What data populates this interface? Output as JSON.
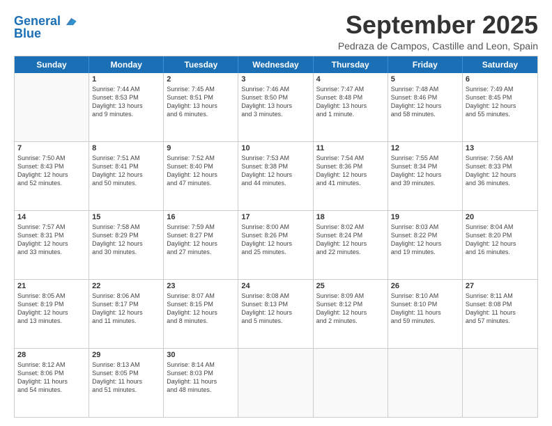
{
  "logo": {
    "line1": "General",
    "line2": "Blue"
  },
  "title": "September 2025",
  "subtitle": "Pedraza de Campos, Castille and Leon, Spain",
  "weekdays": [
    "Sunday",
    "Monday",
    "Tuesday",
    "Wednesday",
    "Thursday",
    "Friday",
    "Saturday"
  ],
  "weeks": [
    [
      {
        "day": "",
        "lines": []
      },
      {
        "day": "1",
        "lines": [
          "Sunrise: 7:44 AM",
          "Sunset: 8:53 PM",
          "Daylight: 13 hours",
          "and 9 minutes."
        ]
      },
      {
        "day": "2",
        "lines": [
          "Sunrise: 7:45 AM",
          "Sunset: 8:51 PM",
          "Daylight: 13 hours",
          "and 6 minutes."
        ]
      },
      {
        "day": "3",
        "lines": [
          "Sunrise: 7:46 AM",
          "Sunset: 8:50 PM",
          "Daylight: 13 hours",
          "and 3 minutes."
        ]
      },
      {
        "day": "4",
        "lines": [
          "Sunrise: 7:47 AM",
          "Sunset: 8:48 PM",
          "Daylight: 13 hours",
          "and 1 minute."
        ]
      },
      {
        "day": "5",
        "lines": [
          "Sunrise: 7:48 AM",
          "Sunset: 8:46 PM",
          "Daylight: 12 hours",
          "and 58 minutes."
        ]
      },
      {
        "day": "6",
        "lines": [
          "Sunrise: 7:49 AM",
          "Sunset: 8:45 PM",
          "Daylight: 12 hours",
          "and 55 minutes."
        ]
      }
    ],
    [
      {
        "day": "7",
        "lines": [
          "Sunrise: 7:50 AM",
          "Sunset: 8:43 PM",
          "Daylight: 12 hours",
          "and 52 minutes."
        ]
      },
      {
        "day": "8",
        "lines": [
          "Sunrise: 7:51 AM",
          "Sunset: 8:41 PM",
          "Daylight: 12 hours",
          "and 50 minutes."
        ]
      },
      {
        "day": "9",
        "lines": [
          "Sunrise: 7:52 AM",
          "Sunset: 8:40 PM",
          "Daylight: 12 hours",
          "and 47 minutes."
        ]
      },
      {
        "day": "10",
        "lines": [
          "Sunrise: 7:53 AM",
          "Sunset: 8:38 PM",
          "Daylight: 12 hours",
          "and 44 minutes."
        ]
      },
      {
        "day": "11",
        "lines": [
          "Sunrise: 7:54 AM",
          "Sunset: 8:36 PM",
          "Daylight: 12 hours",
          "and 41 minutes."
        ]
      },
      {
        "day": "12",
        "lines": [
          "Sunrise: 7:55 AM",
          "Sunset: 8:34 PM",
          "Daylight: 12 hours",
          "and 39 minutes."
        ]
      },
      {
        "day": "13",
        "lines": [
          "Sunrise: 7:56 AM",
          "Sunset: 8:33 PM",
          "Daylight: 12 hours",
          "and 36 minutes."
        ]
      }
    ],
    [
      {
        "day": "14",
        "lines": [
          "Sunrise: 7:57 AM",
          "Sunset: 8:31 PM",
          "Daylight: 12 hours",
          "and 33 minutes."
        ]
      },
      {
        "day": "15",
        "lines": [
          "Sunrise: 7:58 AM",
          "Sunset: 8:29 PM",
          "Daylight: 12 hours",
          "and 30 minutes."
        ]
      },
      {
        "day": "16",
        "lines": [
          "Sunrise: 7:59 AM",
          "Sunset: 8:27 PM",
          "Daylight: 12 hours",
          "and 27 minutes."
        ]
      },
      {
        "day": "17",
        "lines": [
          "Sunrise: 8:00 AM",
          "Sunset: 8:26 PM",
          "Daylight: 12 hours",
          "and 25 minutes."
        ]
      },
      {
        "day": "18",
        "lines": [
          "Sunrise: 8:02 AM",
          "Sunset: 8:24 PM",
          "Daylight: 12 hours",
          "and 22 minutes."
        ]
      },
      {
        "day": "19",
        "lines": [
          "Sunrise: 8:03 AM",
          "Sunset: 8:22 PM",
          "Daylight: 12 hours",
          "and 19 minutes."
        ]
      },
      {
        "day": "20",
        "lines": [
          "Sunrise: 8:04 AM",
          "Sunset: 8:20 PM",
          "Daylight: 12 hours",
          "and 16 minutes."
        ]
      }
    ],
    [
      {
        "day": "21",
        "lines": [
          "Sunrise: 8:05 AM",
          "Sunset: 8:19 PM",
          "Daylight: 12 hours",
          "and 13 minutes."
        ]
      },
      {
        "day": "22",
        "lines": [
          "Sunrise: 8:06 AM",
          "Sunset: 8:17 PM",
          "Daylight: 12 hours",
          "and 11 minutes."
        ]
      },
      {
        "day": "23",
        "lines": [
          "Sunrise: 8:07 AM",
          "Sunset: 8:15 PM",
          "Daylight: 12 hours",
          "and 8 minutes."
        ]
      },
      {
        "day": "24",
        "lines": [
          "Sunrise: 8:08 AM",
          "Sunset: 8:13 PM",
          "Daylight: 12 hours",
          "and 5 minutes."
        ]
      },
      {
        "day": "25",
        "lines": [
          "Sunrise: 8:09 AM",
          "Sunset: 8:12 PM",
          "Daylight: 12 hours",
          "and 2 minutes."
        ]
      },
      {
        "day": "26",
        "lines": [
          "Sunrise: 8:10 AM",
          "Sunset: 8:10 PM",
          "Daylight: 11 hours",
          "and 59 minutes."
        ]
      },
      {
        "day": "27",
        "lines": [
          "Sunrise: 8:11 AM",
          "Sunset: 8:08 PM",
          "Daylight: 11 hours",
          "and 57 minutes."
        ]
      }
    ],
    [
      {
        "day": "28",
        "lines": [
          "Sunrise: 8:12 AM",
          "Sunset: 8:06 PM",
          "Daylight: 11 hours",
          "and 54 minutes."
        ]
      },
      {
        "day": "29",
        "lines": [
          "Sunrise: 8:13 AM",
          "Sunset: 8:05 PM",
          "Daylight: 11 hours",
          "and 51 minutes."
        ]
      },
      {
        "day": "30",
        "lines": [
          "Sunrise: 8:14 AM",
          "Sunset: 8:03 PM",
          "Daylight: 11 hours",
          "and 48 minutes."
        ]
      },
      {
        "day": "",
        "lines": []
      },
      {
        "day": "",
        "lines": []
      },
      {
        "day": "",
        "lines": []
      },
      {
        "day": "",
        "lines": []
      }
    ]
  ]
}
